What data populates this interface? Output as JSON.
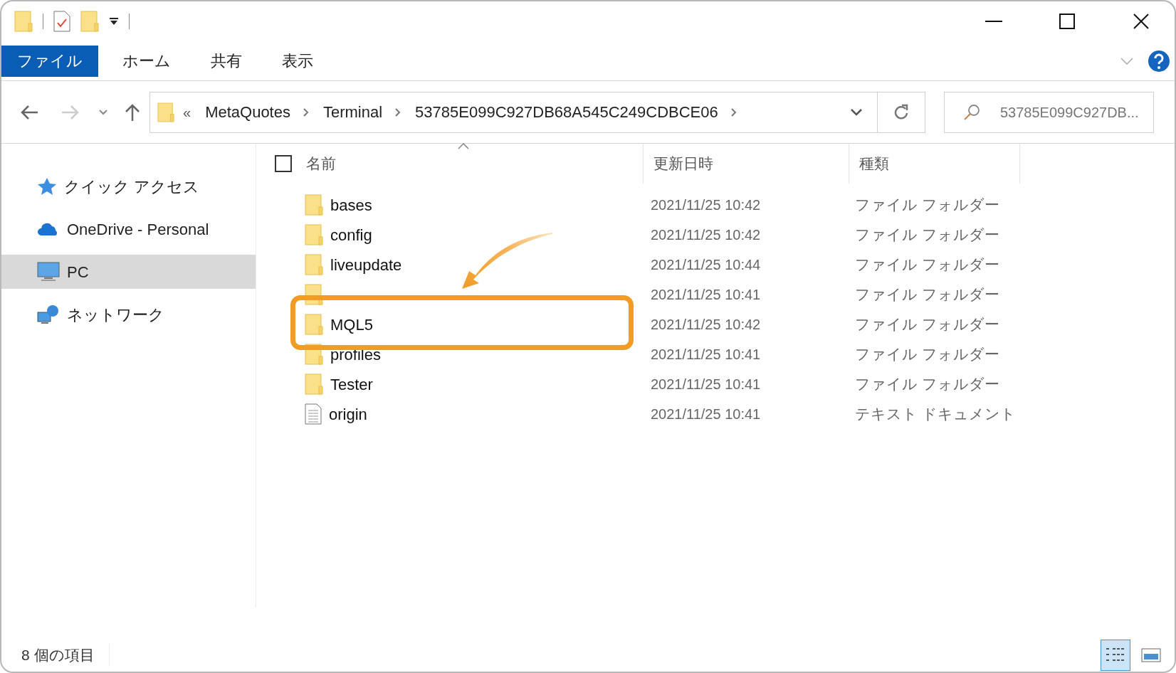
{
  "ribbon": {
    "tabs": [
      {
        "label": "ファイル",
        "selected": true
      },
      {
        "label": "ホーム",
        "selected": false
      },
      {
        "label": "共有",
        "selected": false
      },
      {
        "label": "表示",
        "selected": false
      }
    ]
  },
  "address_bar": {
    "overflow": "«",
    "segments": [
      "MetaQuotes",
      "Terminal",
      "53785E099C927DB68A545C249CDBCE06"
    ]
  },
  "search": {
    "placeholder": "53785E099C927DB..."
  },
  "sidebar": {
    "items": [
      {
        "kind": "quick-access",
        "label": "クイック アクセス",
        "selected": false
      },
      {
        "kind": "cloud",
        "label": "OneDrive - Personal",
        "selected": false
      },
      {
        "kind": "pc",
        "label": "PC",
        "selected": true
      },
      {
        "kind": "network",
        "label": "ネットワーク",
        "selected": false
      }
    ]
  },
  "table": {
    "select_all": {
      "checked": false
    },
    "columns": [
      "名前",
      "更新日時",
      "種類"
    ],
    "rows": [
      {
        "kind": "folder",
        "name": "bases",
        "modified": "2021/11/25 10:42",
        "type": "ファイル フォルダー",
        "highlighted": false
      },
      {
        "kind": "folder",
        "name": "config",
        "modified": "2021/11/25 10:42",
        "type": "ファイル フォルダー",
        "highlighted": false
      },
      {
        "kind": "folder",
        "name": "liveupdate",
        "modified": "2021/11/25 10:44",
        "type": "ファイル フォルダー",
        "highlighted": false
      },
      {
        "kind": "folder",
        "modified": "2021/11/25 10:41",
        "type": "ファイル フォルダー",
        "highlighted": false
      },
      {
        "kind": "folder",
        "name": "MQL5",
        "modified": "2021/11/25 10:42",
        "type": "ファイル フォルダー",
        "highlighted": true
      },
      {
        "kind": "folder",
        "name": "profiles",
        "modified": "2021/11/25 10:41",
        "type": "ファイル フォルダー",
        "highlighted": false
      },
      {
        "kind": "folder",
        "name": "Tester",
        "modified": "2021/11/25 10:41",
        "type": "ファイル フォルダー",
        "highlighted": false
      },
      {
        "kind": "text",
        "name": "origin",
        "modified": "2021/11/25 10:41",
        "type": "テキスト ドキュメント",
        "highlighted": false
      }
    ]
  },
  "status_bar": {
    "item_count": "8 個の項目",
    "views": [
      {
        "kind": "details",
        "selected": true
      },
      {
        "kind": "tiles",
        "selected": false
      }
    ]
  }
}
